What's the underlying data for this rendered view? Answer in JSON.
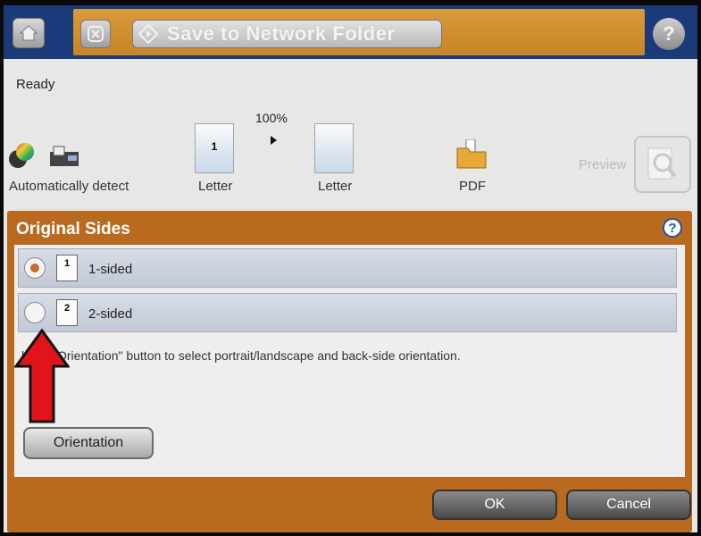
{
  "topbar": {
    "title": "Save to Network Folder",
    "icons": [
      "home-icon",
      "stop-icon",
      "start-icon",
      "help-icon"
    ]
  },
  "status": {
    "text": "Ready"
  },
  "settings": {
    "color_label": "Automatically detect",
    "zoom": "100%",
    "original_size_label": "Letter",
    "original_page_number": "1",
    "output_size_label": "Letter",
    "file_type_label": "PDF",
    "preview_label": "Preview"
  },
  "dialog": {
    "title": "Original Sides",
    "options": [
      {
        "label": "1-sided",
        "icon_number": "1",
        "selected": true
      },
      {
        "label": "2-sided",
        "icon_number": "2",
        "selected": false
      }
    ],
    "hint": "h the \"Orientation\" button to select portrait/landscape and back-side orientation.",
    "orientation_button": "Orientation",
    "ok_button": "OK",
    "cancel_button": "Cancel"
  },
  "colors": {
    "header_band": "#c78526",
    "header_edge": "#1a3a7a",
    "dialog_frame": "#b96a1f",
    "radio_selected": "#c76b2b",
    "annotation_arrow": "#e0141a"
  }
}
